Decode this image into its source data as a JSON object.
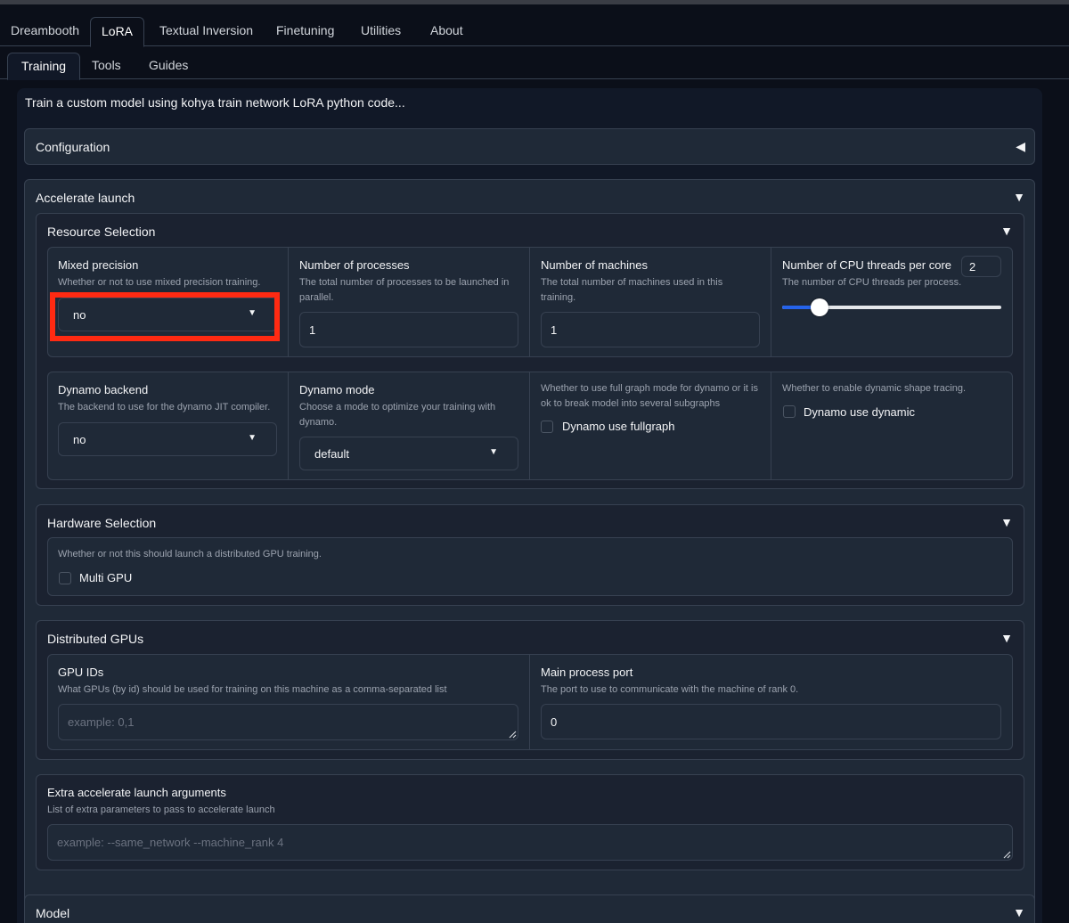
{
  "tabs": [
    "Dreambooth",
    "LoRA",
    "Textual Inversion",
    "Finetuning",
    "Utilities",
    "About"
  ],
  "subtabs": [
    "Training",
    "Tools",
    "Guides"
  ],
  "intro": "Train a custom model using kohya train network LoRA python code...",
  "configuration": {
    "title": "Configuration",
    "arrow": "◀"
  },
  "accelerate": {
    "title": "Accelerate launch",
    "arrow": "▼"
  },
  "resource": {
    "title": "Resource Selection",
    "arrow": "▼",
    "mixed_precision": {
      "label": "Mixed precision",
      "desc": "Whether or not to use mixed precision training.",
      "value": "no",
      "caret": "▼"
    },
    "num_processes": {
      "label": "Number of processes",
      "desc": "The total number of processes to be launched in parallel.",
      "value": "1"
    },
    "num_machines": {
      "label": "Number of machines",
      "desc": "The total number of machines used in this training.",
      "value": "1"
    },
    "cpu_threads": {
      "label": "Number of CPU threads per core",
      "desc": "The number of CPU threads per process.",
      "value": "2",
      "slider_fraction": 0.17
    },
    "dynamo_backend": {
      "label": "Dynamo backend",
      "desc": "The backend to use for the dynamo JIT compiler.",
      "value": "no",
      "caret": "▼"
    },
    "dynamo_mode": {
      "label": "Dynamo mode",
      "desc": "Choose a mode to optimize your training with dynamo.",
      "value": "default",
      "caret": "▼"
    },
    "dynamo_fullgraph": {
      "desc": "Whether to use full graph mode for dynamo or it is ok to break model into several subgraphs",
      "label": "Dynamo use fullgraph"
    },
    "dynamo_dynamic": {
      "desc": "Whether to enable dynamic shape tracing.",
      "label": "Dynamo use dynamic"
    }
  },
  "hardware": {
    "title": "Hardware Selection",
    "arrow": "▼",
    "desc": "Whether or not this should launch a distributed GPU training.",
    "multi_gpu": "Multi GPU"
  },
  "distributed": {
    "title": "Distributed GPUs",
    "arrow": "▼",
    "gpu_ids": {
      "label": "GPU IDs",
      "desc": "What GPUs (by id) should be used for training on this machine as a comma-separated list",
      "placeholder": "example: 0,1"
    },
    "main_port": {
      "label": "Main process port",
      "desc": "The port to use to communicate with the machine of rank 0.",
      "value": "0"
    }
  },
  "extra": {
    "label": "Extra accelerate launch arguments",
    "desc": "List of extra parameters to pass to accelerate launch",
    "placeholder": "example: --same_network --machine_rank 4"
  },
  "model": {
    "title": "Model",
    "arrow": "▼"
  },
  "colors": {
    "accent": "#2563eb",
    "highlight": "#ff2a12",
    "background": "#0b0f19"
  }
}
